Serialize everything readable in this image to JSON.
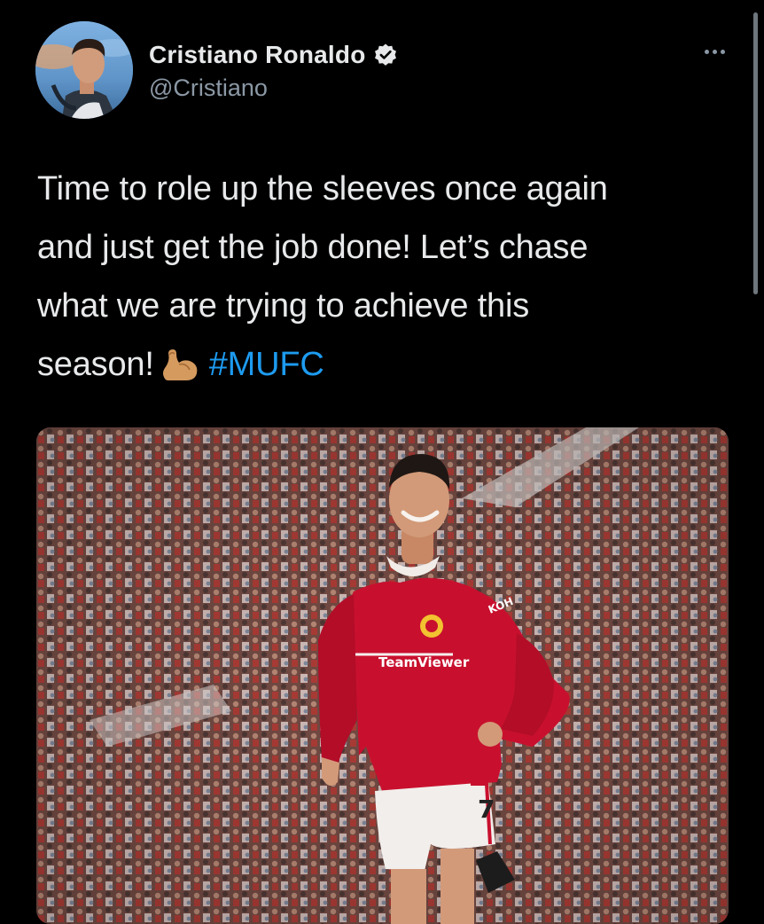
{
  "author": {
    "display_name": "Cristiano Ronaldo",
    "handle": "@Cristiano",
    "verified": true
  },
  "tweet": {
    "text_lines": [
      "Time to role up the sleeves once again",
      "and just get the job done! Let’s chase",
      "what we are trying to achieve this",
      "season!"
    ],
    "emoji": "flexed-biceps",
    "hashtag": "#MUFC"
  },
  "media": {
    "kit_sponsor_text": "TeamViewer",
    "sleeve_sponsor_text": "KOH",
    "shirt_number": "7"
  },
  "icons": {
    "more": "more-horizontal-icon",
    "verified": "verified-badge-icon"
  },
  "colors": {
    "background": "#000000",
    "text_primary": "#e7e9ea",
    "text_secondary": "#8b98a5",
    "hashtag": "#1d9bf0",
    "jersey_red": "#c8102e"
  }
}
